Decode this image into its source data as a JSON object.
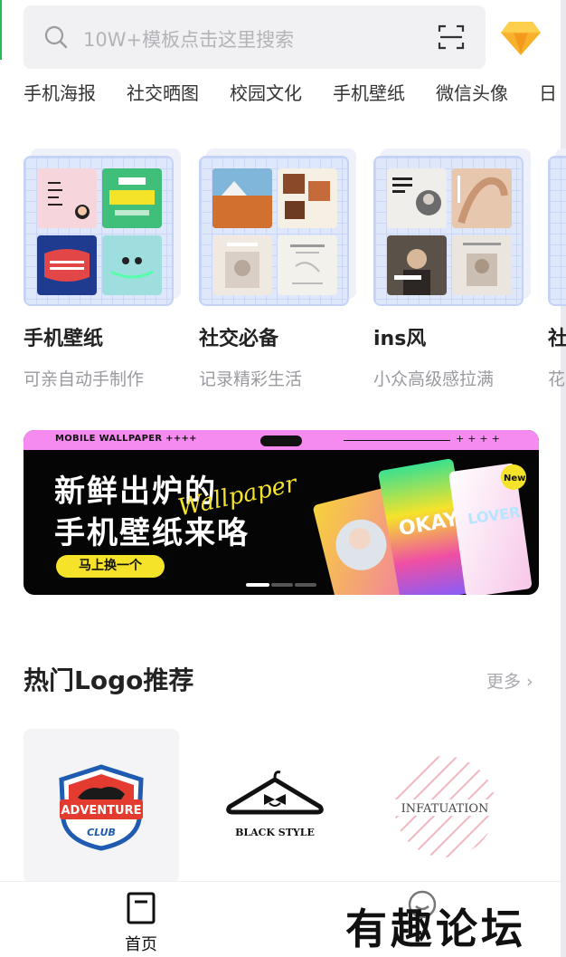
{
  "search": {
    "placeholder": "10W+模板点击这里搜索"
  },
  "categories": [
    "手机海报",
    "社交晒图",
    "校园文化",
    "手机壁纸",
    "微信头像",
    "日"
  ],
  "templates": [
    {
      "title": "手机壁纸",
      "subtitle": "可亲自动手制作"
    },
    {
      "title": "社交必备",
      "subtitle": "记录精彩生活"
    },
    {
      "title": "ins风",
      "subtitle": "小众高级感拉满"
    },
    {
      "title": "社",
      "subtitle": "花"
    }
  ],
  "banner": {
    "tag": "MOBILE WALLPAPER ++++",
    "stars": "++++",
    "headline_1": "新鲜出炉的",
    "headline_2": "手机壁纸来咯",
    "script": "Wallpaper",
    "button": "马上换一个",
    "phone_text_1": "OKAY",
    "phone_text_2": "New"
  },
  "logos": {
    "title": "热门Logo推荐",
    "more": "更多 ›",
    "items": [
      {
        "top": "ADVENTURE",
        "bottom": "CLUB"
      },
      {
        "text": "BLACK STYLE"
      },
      {
        "text": "INFATUATION"
      }
    ]
  },
  "nav": {
    "home": "首页"
  },
  "watermark": "有趣论坛",
  "colors": {
    "accent": "#f5e32a",
    "banner_pink": "#f58bf0",
    "card_blue": "#dfe7fb"
  }
}
